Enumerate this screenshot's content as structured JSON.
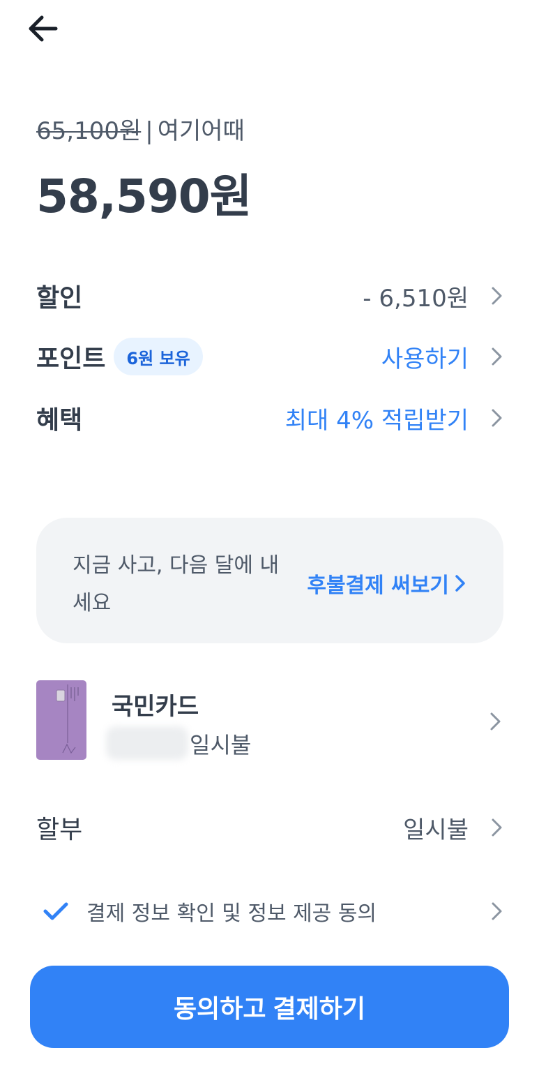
{
  "header": {
    "back_icon": "arrow-left-icon"
  },
  "price": {
    "original": "65,100원",
    "separator": "|",
    "merchant": "여기어때",
    "final": "58,590원"
  },
  "rows": {
    "discount": {
      "label": "할인",
      "value": "- 6,510원"
    },
    "points": {
      "label": "포인트",
      "badge": "6원 보유",
      "value": "사용하기"
    },
    "benefits": {
      "label": "혜택",
      "value": "최대 4% 적립받기"
    },
    "installment": {
      "label": "할부",
      "value": "일시불"
    }
  },
  "promo": {
    "text": "지금 사고, 다음 달에 내세요",
    "link": "후불결제 써보기"
  },
  "card": {
    "name": "국민카드",
    "plan": "일시불",
    "card_color": "#a685c2"
  },
  "agreement": {
    "text": "결제 정보 확인 및 정보 제공 동의",
    "checked": true
  },
  "submit": {
    "label": "동의하고 결제하기"
  },
  "colors": {
    "accent": "#3182f6",
    "text_primary": "#333d4b",
    "text_secondary": "#4e5968",
    "badge_bg": "#e8f3ff",
    "promo_bg": "#f2f4f6"
  }
}
